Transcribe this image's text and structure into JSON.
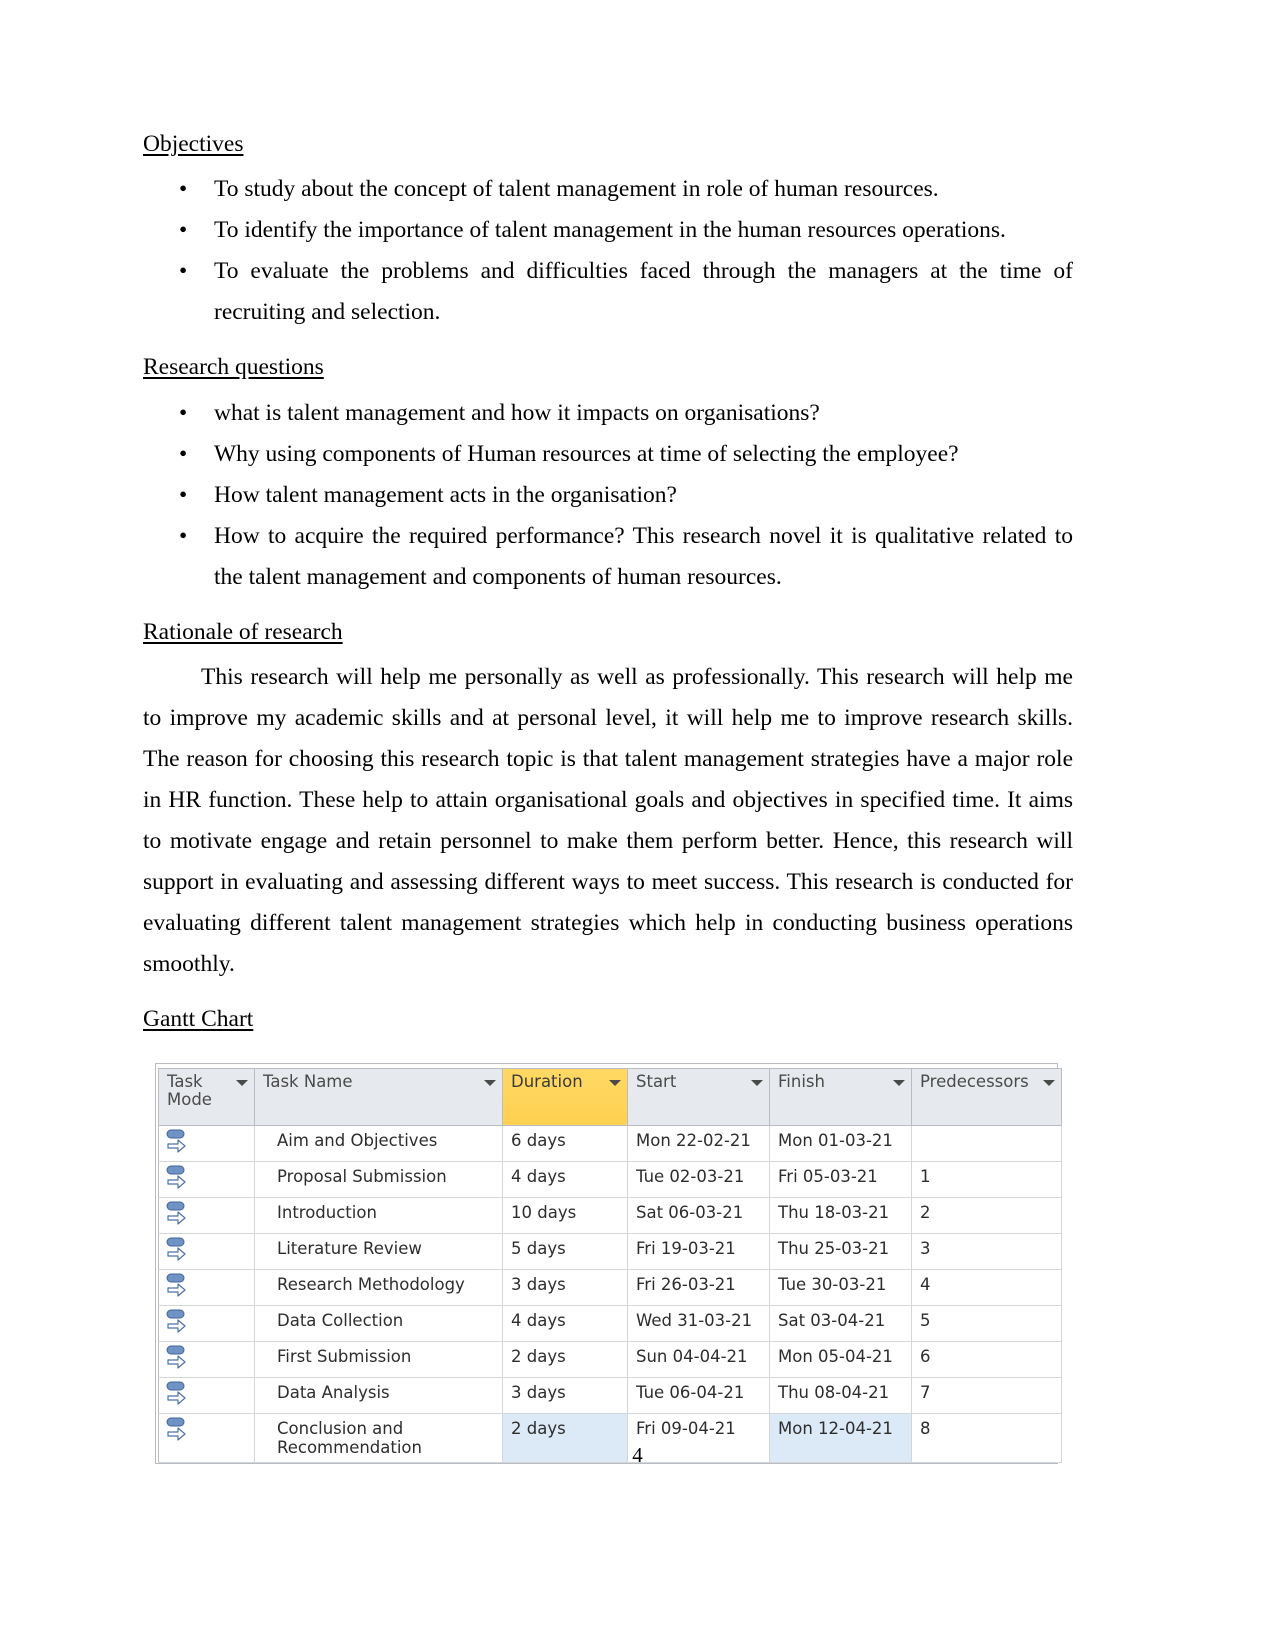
{
  "page": {
    "number": "4"
  },
  "sections": [
    {
      "id": "objectives",
      "heading": "Objectives",
      "bullets": [
        "To study about the concept of talent management in role of human resources.",
        "To identify the importance of talent management in the human resources operations.",
        "To evaluate the problems and difficulties faced through the managers at the time of recruiting and selection."
      ]
    },
    {
      "id": "research-questions",
      "heading": "Research questions",
      "bullets": [
        "what is talent management and how it impacts on organisations?",
        "Why using components of Human resources at time of selecting the employee?",
        "How talent management acts in the organisation?",
        "How to acquire the required performance? This research novel it is qualitative related to the talent management and components of human resources."
      ]
    },
    {
      "id": "rationale",
      "heading": "Rationale of research",
      "paragraph": "This research will help me personally as well as professionally. This research will help me to improve my academic skills and at personal level, it will help me to improve research skills. The reason for choosing this research topic is that talent management strategies have a major role in HR function. These help to attain organisational goals and objectives in specified time. It aims to motivate engage and retain personnel to make them perform better. Hence, this research will support in evaluating and assessing different ways to meet success.  This research is conducted for evaluating different talent management strategies which help in conducting business operations smoothly."
    },
    {
      "id": "gantt",
      "heading": "Gantt Chart "
    }
  ],
  "bullet_glyph": "•",
  "gantt_table": {
    "columns": [
      {
        "key": "mode",
        "label": "Task\nMode",
        "highlighted": false,
        "has_caret": true
      },
      {
        "key": "name",
        "label": "Task Name",
        "highlighted": false,
        "has_caret": true
      },
      {
        "key": "dur",
        "label": "Duration",
        "highlighted": true,
        "has_caret": true
      },
      {
        "key": "start",
        "label": "Start",
        "highlighted": false,
        "has_caret": true
      },
      {
        "key": "fin",
        "label": "Finish",
        "highlighted": false,
        "has_caret": true
      },
      {
        "key": "pred",
        "label": "Predecessors",
        "highlighted": false,
        "has_caret": true
      }
    ],
    "highlight_color": "#ffd464",
    "header_bg": "#e6e9ed",
    "selected_cell_bg": "#dce9f7",
    "task_mode_icon": "auto-schedule-icon",
    "rows": [
      {
        "name": "Aim and Objectives",
        "dur": "6 days",
        "start": "Mon 22-02-21",
        "fin": "Mon 01-03-21",
        "pred": "",
        "shaded": false
      },
      {
        "name": "Proposal Submission",
        "dur": "4 days",
        "start": "Tue 02-03-21",
        "fin": "Fri 05-03-21",
        "pred": "1",
        "shaded": false
      },
      {
        "name": "Introduction",
        "dur": "10 days",
        "start": "Sat 06-03-21",
        "fin": "Thu 18-03-21",
        "pred": "2",
        "shaded": false
      },
      {
        "name": "Literature Review",
        "dur": "5 days",
        "start": "Fri 19-03-21",
        "fin": "Thu 25-03-21",
        "pred": "3",
        "shaded": false
      },
      {
        "name": "Research Methodology",
        "dur": "3 days",
        "start": "Fri 26-03-21",
        "fin": "Tue 30-03-21",
        "pred": "4",
        "shaded": false
      },
      {
        "name": "Data Collection",
        "dur": "4 days",
        "start": "Wed 31-03-21",
        "fin": "Sat 03-04-21",
        "pred": "5",
        "shaded": false
      },
      {
        "name": "First Submission",
        "dur": "2 days",
        "start": "Sun 04-04-21",
        "fin": "Mon 05-04-21",
        "pred": "6",
        "shaded": false
      },
      {
        "name": "Data Analysis",
        "dur": "3 days",
        "start": "Tue 06-04-21",
        "fin": "Thu 08-04-21",
        "pred": "7",
        "shaded": false
      },
      {
        "name": "Conclusion and Recommendation",
        "dur": "2 days",
        "start": "Fri 09-04-21",
        "fin": "Mon 12-04-21",
        "pred": "8",
        "shaded": true
      }
    ]
  }
}
